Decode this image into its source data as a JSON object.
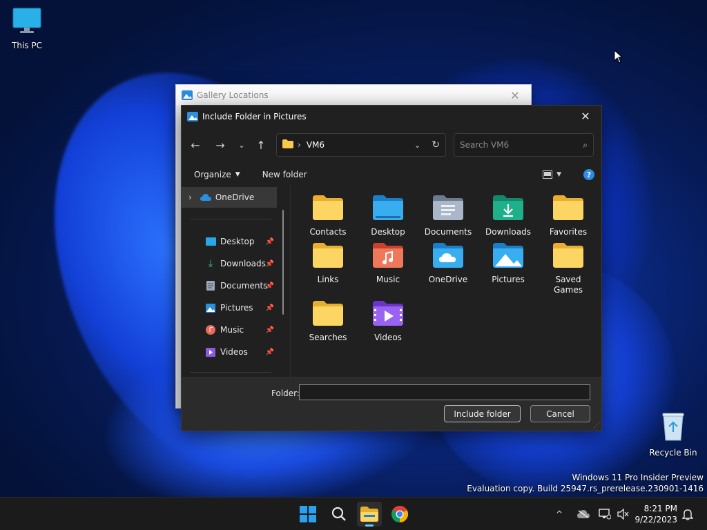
{
  "desktop": {
    "icons": [
      {
        "label": "This PC",
        "icon": "monitor-icon"
      },
      {
        "label": "Recycle Bin",
        "icon": "recycle-bin-icon"
      }
    ],
    "watermark": {
      "line1": "Windows 11 Pro Insider Preview",
      "line2": "Evaluation copy. Build 25947.rs_prerelease.230901-1416"
    }
  },
  "background_window": {
    "title": "Gallery Locations",
    "close_icon": "close-icon"
  },
  "dialog": {
    "title": "Include Folder in Pictures",
    "address": {
      "path": "VM6",
      "folder_icon": "folder-icon"
    },
    "search_placeholder": "Search VM6",
    "commands": {
      "organize": "Organize",
      "new_folder": "New folder",
      "help": "?"
    },
    "nav_pane": {
      "items": [
        {
          "label": "OneDrive",
          "icon": "onedrive-icon",
          "expandable": true,
          "selected": true
        },
        {
          "label": "Desktop",
          "icon": "desktop-icon",
          "pinned": true
        },
        {
          "label": "Downloads",
          "icon": "downloads-icon",
          "pinned": true
        },
        {
          "label": "Documents",
          "icon": "documents-icon",
          "pinned": true
        },
        {
          "label": "Pictures",
          "icon": "pictures-icon",
          "pinned": true
        },
        {
          "label": "Music",
          "icon": "music-icon",
          "pinned": true
        },
        {
          "label": "Videos",
          "icon": "videos-icon",
          "pinned": true
        }
      ]
    },
    "folders": [
      {
        "label": "Contacts",
        "icon": "folder-icon"
      },
      {
        "label": "Desktop",
        "icon": "desktop-folder-icon"
      },
      {
        "label": "Documents",
        "icon": "documents-folder-icon"
      },
      {
        "label": "Downloads",
        "icon": "downloads-folder-icon"
      },
      {
        "label": "Favorites",
        "icon": "folder-icon"
      },
      {
        "label": "Links",
        "icon": "folder-icon"
      },
      {
        "label": "Music",
        "icon": "music-folder-icon"
      },
      {
        "label": "OneDrive",
        "icon": "onedrive-folder-icon"
      },
      {
        "label": "Pictures",
        "icon": "pictures-folder-icon"
      },
      {
        "label": "Saved Games",
        "icon": "folder-icon"
      },
      {
        "label": "Searches",
        "icon": "folder-icon"
      },
      {
        "label": "Videos",
        "icon": "videos-folder-icon"
      }
    ],
    "folder_field": {
      "label": "Folder:",
      "value": ""
    },
    "buttons": {
      "include": "Include folder",
      "cancel": "Cancel"
    }
  },
  "taskbar": {
    "apps": [
      "start-icon",
      "search-icon",
      "file-explorer-icon",
      "chrome-icon"
    ],
    "clock": {
      "time": "8:21 PM",
      "date": "9/22/2023"
    }
  },
  "colors": {
    "accent": "#60cdff",
    "folder_yellow": "#f8c94a",
    "dialog_bg": "#202020"
  }
}
